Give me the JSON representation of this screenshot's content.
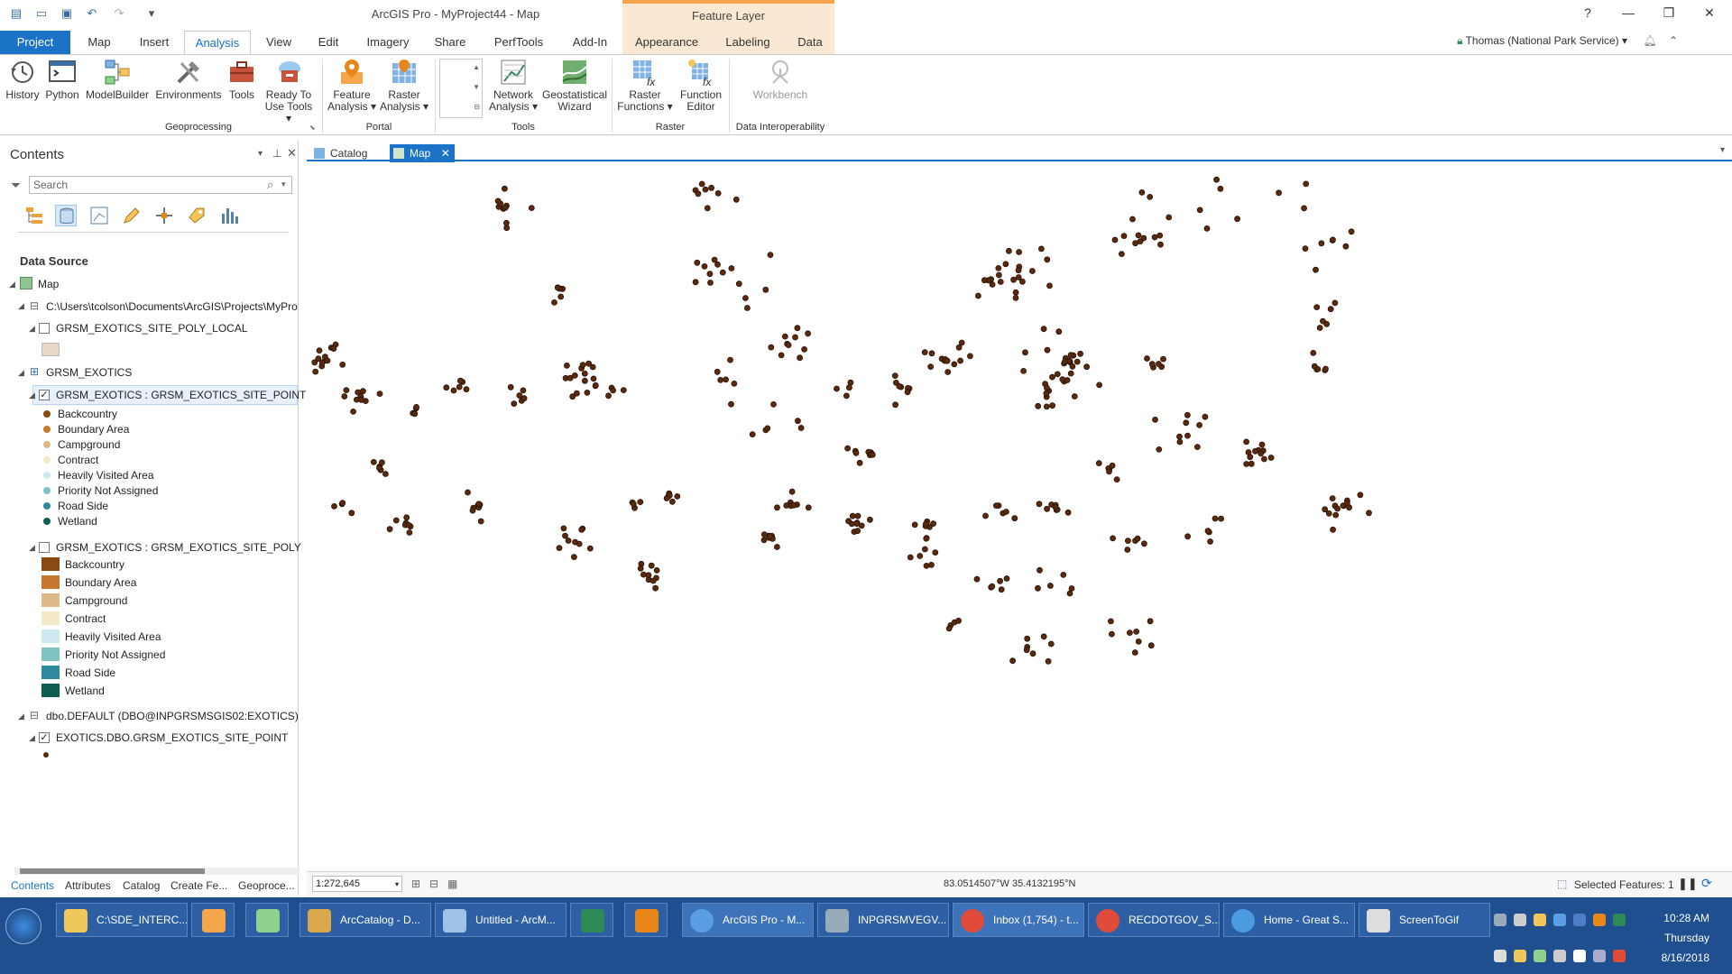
{
  "window": {
    "title": "ArcGIS Pro - MyProject44 - Map",
    "context_tab": "Feature Layer",
    "help": "?",
    "min": "—",
    "restore": "❐",
    "close": "✕"
  },
  "tabs": [
    "Project",
    "Map",
    "Insert",
    "Analysis",
    "View",
    "Edit",
    "Imagery",
    "Share",
    "PerfTools",
    "Add-In",
    "Appearance",
    "Labeling",
    "Data"
  ],
  "user": "Thomas (National Park Service) ▾",
  "ribbon": {
    "buttons": [
      {
        "label": "History",
        "icon": "history-icon"
      },
      {
        "label": "Python",
        "icon": "python-icon"
      },
      {
        "label": "ModelBuilder",
        "icon": "modelbuilder-icon"
      },
      {
        "label": "Environments",
        "icon": "environments-icon"
      },
      {
        "label": "Tools",
        "icon": "toolbox-icon"
      },
      {
        "label": "Ready To Use Tools ▾",
        "icon": "ready-to-use-icon"
      },
      {
        "label": "Feature Analysis ▾",
        "icon": "feature-analysis-icon"
      },
      {
        "label": "Raster Analysis ▾",
        "icon": "raster-analysis-icon"
      },
      {
        "label": "Network Analysis ▾",
        "icon": "network-analysis-icon"
      },
      {
        "label": "Geostatistical Wizard",
        "icon": "geostatistical-icon"
      },
      {
        "label": "Raster Functions ▾",
        "icon": "raster-functions-icon"
      },
      {
        "label": "Function Editor",
        "icon": "function-editor-icon"
      },
      {
        "label": "Workbench",
        "icon": "workbench-icon"
      }
    ],
    "groups": [
      "Geoprocessing",
      "Portal",
      "Tools",
      "Raster",
      "Data Interoperability"
    ]
  },
  "contents": {
    "title": "Contents",
    "search_placeholder": "Search",
    "section": "Data Source",
    "tree": {
      "map": "Map",
      "path": "C:\\Users\\tcolson\\Documents\\ArcGIS\\Projects\\MyPro",
      "poly_local": "GRSM_EXOTICS_SITE_POLY_LOCAL",
      "db": "GRSM_EXOTICS",
      "point_layer": "GRSM_EXOTICS : GRSM_EXOTICS_SITE_POINT",
      "poly_layer": "GRSM_EXOTICS : GRSM_EXOTICS_SITE_POLY",
      "dbo": "dbo.DEFAULT (DBO@INPGRSMSGIS02:EXOTICS)",
      "dbo_point": "EXOTICS.DBO.GRSM_EXOTICS_SITE_POINT"
    },
    "legend_point": [
      {
        "label": "Backcountry",
        "color": "#8b4a12"
      },
      {
        "label": "Boundary Area",
        "color": "#c8782e"
      },
      {
        "label": "Campground",
        "color": "#deb887"
      },
      {
        "label": "Contract",
        "color": "#f3e9c6"
      },
      {
        "label": "Heavily Visited Area",
        "color": "#cde8ee"
      },
      {
        "label": "Priority Not Assigned",
        "color": "#7fc4c2"
      },
      {
        "label": "Road Side",
        "color": "#2f8aa0"
      },
      {
        "label": "Wetland",
        "color": "#0f5e52"
      }
    ],
    "legend_poly": [
      {
        "label": "Backcountry",
        "color": "#8b4a12"
      },
      {
        "label": "Boundary Area",
        "color": "#c8782e"
      },
      {
        "label": "Campground",
        "color": "#deb887"
      },
      {
        "label": "Contract",
        "color": "#f3e9c6"
      },
      {
        "label": "Heavily Visited Area",
        "color": "#cde8ee"
      },
      {
        "label": "Priority Not Assigned",
        "color": "#7fc4c2"
      },
      {
        "label": "Road Side",
        "color": "#2f8aa0"
      },
      {
        "label": "Wetland",
        "color": "#0f5e52"
      }
    ],
    "footer_tabs": [
      "Contents",
      "Attributes",
      "Catalog",
      "Create Fe...",
      "Geoproce..."
    ]
  },
  "dock_tabs": [
    "Catalog",
    "Map"
  ],
  "status": {
    "scale": "1:272,645",
    "coordinates": "83.0514507°W 35.4132195°N",
    "selected": "Selected Features: 1"
  },
  "taskbar": {
    "items": [
      "C:\\SDE_INTERC...",
      "ArcCatalog - D...",
      "Untitled - ArcM...",
      "ArcGIS Pro - M...",
      "INPGRSMVEGV...",
      "Inbox (1,754) - t...",
      "RECDOTGOV_S...",
      "Home - Great S...",
      "ScreenToGif"
    ],
    "time": "10:28 AM",
    "day": "Thursday",
    "date": "8/16/2018"
  },
  "colors": {
    "accent": "#1a73c6",
    "point": "#5a2a0e",
    "taskbar": "#1f4f8f"
  }
}
